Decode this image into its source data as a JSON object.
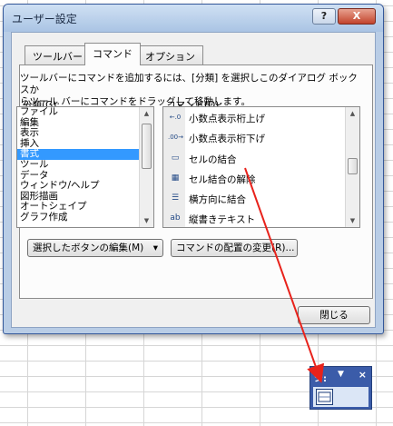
{
  "dialog": {
    "title": "ユーザー設定",
    "help_label": "?",
    "close_label": "X",
    "tabs": [
      {
        "label": "ツールバー"
      },
      {
        "label": "コマンド"
      },
      {
        "label": "オプション"
      }
    ],
    "description_line1": "ツールバーにコマンドを追加するには、[分類] を選択しこのダイアログ ボックスか",
    "description_line2": "らツール バーにコマンドをドラッグして移動します。",
    "categories_label": "分類(G):",
    "commands_label": "コマンド(D):",
    "categories": [
      "ファイル",
      "編集",
      "表示",
      "挿入",
      "書式",
      "ツール",
      "データ",
      "ウィンドウ/ヘルプ",
      "図形描画",
      "オートシェイプ",
      "グラフ作成"
    ],
    "selected_category": "書式",
    "commands": [
      {
        "label": "小数点表示桁上げ",
        "icon": "increase-decimal-icon"
      },
      {
        "label": "小数点表示桁下げ",
        "icon": "decrease-decimal-icon"
      },
      {
        "label": "セルの結合",
        "icon": "merge-cells-icon"
      },
      {
        "label": "セル結合の解除",
        "icon": "unmerge-cells-icon"
      },
      {
        "label": "横方向に結合",
        "icon": "merge-across-icon"
      },
      {
        "label": "縦書きテキスト",
        "icon": "vertical-text-icon"
      }
    ],
    "edit_selection_button": "選択したボタンの編集(M)",
    "edit_selection_arrow": "▾",
    "rearrange_button": "コマンドの配置の変更(R)...",
    "close_button": "閉じる"
  },
  "floating_toolbar": {
    "title": "シ:",
    "close_label": "×"
  },
  "colors": {
    "selection": "#3399ff",
    "drag_arrow": "#e8221b",
    "dialog_frame": "#b9cde6",
    "toolbar_blue": "#3b5ca9"
  }
}
